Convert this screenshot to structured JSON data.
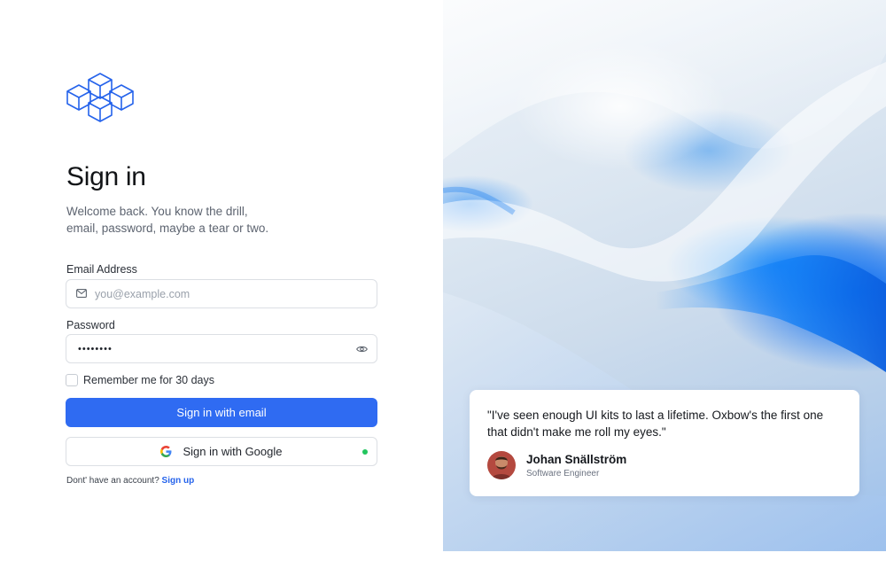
{
  "brand": {
    "logo_icon": "cubes-logo-icon",
    "accent_color": "#2f6bf2"
  },
  "header": {
    "title": "Sign in",
    "subtitle_line1": "Welcome back. You know the drill,",
    "subtitle_line2": "email, password, maybe a tear or two."
  },
  "form": {
    "email_label": "Email Address",
    "email_placeholder": "you@example.com",
    "email_value": "",
    "email_icon": "mail-icon",
    "password_label": "Password",
    "password_value": "••••••••",
    "password_toggle_icon": "eye-icon",
    "remember_label": "Remember me for 30 days",
    "remember_checked": false,
    "submit_label": "Sign in with email",
    "google_label": "Sign in with Google",
    "google_icon": "google-icon",
    "google_status_color": "#22c55e"
  },
  "footer": {
    "signup_prompt": "Dont' have an account?",
    "signup_link": "Sign up"
  },
  "testimonial": {
    "quote": "\"I've seen enough UI kits to last a lifetime. Oxbow's the first one that didn't make me roll my eyes.\"",
    "name": "Johan Snällström",
    "role": "Software Engineer",
    "avatar_icon": "avatar"
  }
}
